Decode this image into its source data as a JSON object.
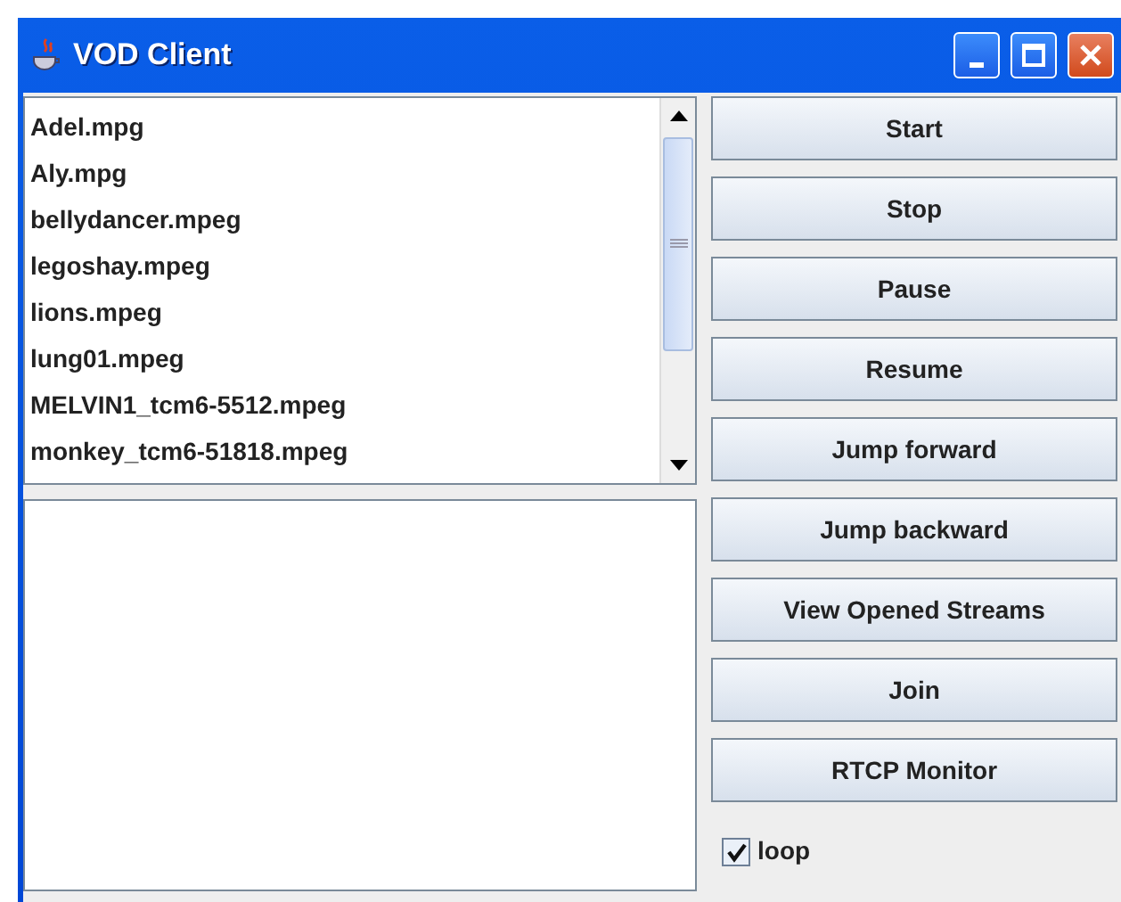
{
  "window": {
    "title": "VOD Client"
  },
  "files": [
    {
      "name": "Adel.mpg"
    },
    {
      "name": "Aly.mpg"
    },
    {
      "name": "bellydancer.mpeg"
    },
    {
      "name": "legoshay.mpeg"
    },
    {
      "name": "lions.mpeg"
    },
    {
      "name": "lung01.mpeg"
    },
    {
      "name": "MELVIN1_tcm6-5512.mpeg"
    },
    {
      "name": "monkey_tcm6-51818.mpeg"
    }
  ],
  "buttons": [
    "Start",
    "Stop",
    "Pause",
    "Resume",
    "Jump forward",
    "Jump backward",
    "View Opened Streams",
    "Join",
    "RTCP Monitor"
  ],
  "loop": {
    "label": "loop",
    "checked": true
  }
}
